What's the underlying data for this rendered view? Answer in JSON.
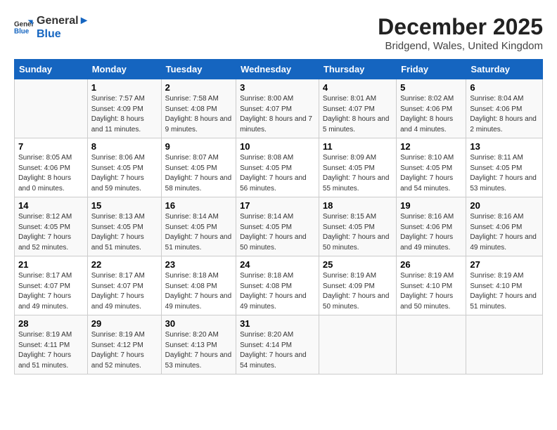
{
  "logo": {
    "line1": "General",
    "line2": "Blue"
  },
  "title": "December 2025",
  "subtitle": "Bridgend, Wales, United Kingdom",
  "days_of_week": [
    "Sunday",
    "Monday",
    "Tuesday",
    "Wednesday",
    "Thursday",
    "Friday",
    "Saturday"
  ],
  "weeks": [
    [
      {
        "day": "",
        "sunrise": "",
        "sunset": "",
        "daylight": ""
      },
      {
        "day": "1",
        "sunrise": "Sunrise: 7:57 AM",
        "sunset": "Sunset: 4:09 PM",
        "daylight": "Daylight: 8 hours and 11 minutes."
      },
      {
        "day": "2",
        "sunrise": "Sunrise: 7:58 AM",
        "sunset": "Sunset: 4:08 PM",
        "daylight": "Daylight: 8 hours and 9 minutes."
      },
      {
        "day": "3",
        "sunrise": "Sunrise: 8:00 AM",
        "sunset": "Sunset: 4:07 PM",
        "daylight": "Daylight: 8 hours and 7 minutes."
      },
      {
        "day": "4",
        "sunrise": "Sunrise: 8:01 AM",
        "sunset": "Sunset: 4:07 PM",
        "daylight": "Daylight: 8 hours and 5 minutes."
      },
      {
        "day": "5",
        "sunrise": "Sunrise: 8:02 AM",
        "sunset": "Sunset: 4:06 PM",
        "daylight": "Daylight: 8 hours and 4 minutes."
      },
      {
        "day": "6",
        "sunrise": "Sunrise: 8:04 AM",
        "sunset": "Sunset: 4:06 PM",
        "daylight": "Daylight: 8 hours and 2 minutes."
      }
    ],
    [
      {
        "day": "7",
        "sunrise": "Sunrise: 8:05 AM",
        "sunset": "Sunset: 4:06 PM",
        "daylight": "Daylight: 8 hours and 0 minutes."
      },
      {
        "day": "8",
        "sunrise": "Sunrise: 8:06 AM",
        "sunset": "Sunset: 4:05 PM",
        "daylight": "Daylight: 7 hours and 59 minutes."
      },
      {
        "day": "9",
        "sunrise": "Sunrise: 8:07 AM",
        "sunset": "Sunset: 4:05 PM",
        "daylight": "Daylight: 7 hours and 58 minutes."
      },
      {
        "day": "10",
        "sunrise": "Sunrise: 8:08 AM",
        "sunset": "Sunset: 4:05 PM",
        "daylight": "Daylight: 7 hours and 56 minutes."
      },
      {
        "day": "11",
        "sunrise": "Sunrise: 8:09 AM",
        "sunset": "Sunset: 4:05 PM",
        "daylight": "Daylight: 7 hours and 55 minutes."
      },
      {
        "day": "12",
        "sunrise": "Sunrise: 8:10 AM",
        "sunset": "Sunset: 4:05 PM",
        "daylight": "Daylight: 7 hours and 54 minutes."
      },
      {
        "day": "13",
        "sunrise": "Sunrise: 8:11 AM",
        "sunset": "Sunset: 4:05 PM",
        "daylight": "Daylight: 7 hours and 53 minutes."
      }
    ],
    [
      {
        "day": "14",
        "sunrise": "Sunrise: 8:12 AM",
        "sunset": "Sunset: 4:05 PM",
        "daylight": "Daylight: 7 hours and 52 minutes."
      },
      {
        "day": "15",
        "sunrise": "Sunrise: 8:13 AM",
        "sunset": "Sunset: 4:05 PM",
        "daylight": "Daylight: 7 hours and 51 minutes."
      },
      {
        "day": "16",
        "sunrise": "Sunrise: 8:14 AM",
        "sunset": "Sunset: 4:05 PM",
        "daylight": "Daylight: 7 hours and 51 minutes."
      },
      {
        "day": "17",
        "sunrise": "Sunrise: 8:14 AM",
        "sunset": "Sunset: 4:05 PM",
        "daylight": "Daylight: 7 hours and 50 minutes."
      },
      {
        "day": "18",
        "sunrise": "Sunrise: 8:15 AM",
        "sunset": "Sunset: 4:05 PM",
        "daylight": "Daylight: 7 hours and 50 minutes."
      },
      {
        "day": "19",
        "sunrise": "Sunrise: 8:16 AM",
        "sunset": "Sunset: 4:06 PM",
        "daylight": "Daylight: 7 hours and 49 minutes."
      },
      {
        "day": "20",
        "sunrise": "Sunrise: 8:16 AM",
        "sunset": "Sunset: 4:06 PM",
        "daylight": "Daylight: 7 hours and 49 minutes."
      }
    ],
    [
      {
        "day": "21",
        "sunrise": "Sunrise: 8:17 AM",
        "sunset": "Sunset: 4:07 PM",
        "daylight": "Daylight: 7 hours and 49 minutes."
      },
      {
        "day": "22",
        "sunrise": "Sunrise: 8:17 AM",
        "sunset": "Sunset: 4:07 PM",
        "daylight": "Daylight: 7 hours and 49 minutes."
      },
      {
        "day": "23",
        "sunrise": "Sunrise: 8:18 AM",
        "sunset": "Sunset: 4:08 PM",
        "daylight": "Daylight: 7 hours and 49 minutes."
      },
      {
        "day": "24",
        "sunrise": "Sunrise: 8:18 AM",
        "sunset": "Sunset: 4:08 PM",
        "daylight": "Daylight: 7 hours and 49 minutes."
      },
      {
        "day": "25",
        "sunrise": "Sunrise: 8:19 AM",
        "sunset": "Sunset: 4:09 PM",
        "daylight": "Daylight: 7 hours and 50 minutes."
      },
      {
        "day": "26",
        "sunrise": "Sunrise: 8:19 AM",
        "sunset": "Sunset: 4:10 PM",
        "daylight": "Daylight: 7 hours and 50 minutes."
      },
      {
        "day": "27",
        "sunrise": "Sunrise: 8:19 AM",
        "sunset": "Sunset: 4:10 PM",
        "daylight": "Daylight: 7 hours and 51 minutes."
      }
    ],
    [
      {
        "day": "28",
        "sunrise": "Sunrise: 8:19 AM",
        "sunset": "Sunset: 4:11 PM",
        "daylight": "Daylight: 7 hours and 51 minutes."
      },
      {
        "day": "29",
        "sunrise": "Sunrise: 8:19 AM",
        "sunset": "Sunset: 4:12 PM",
        "daylight": "Daylight: 7 hours and 52 minutes."
      },
      {
        "day": "30",
        "sunrise": "Sunrise: 8:20 AM",
        "sunset": "Sunset: 4:13 PM",
        "daylight": "Daylight: 7 hours and 53 minutes."
      },
      {
        "day": "31",
        "sunrise": "Sunrise: 8:20 AM",
        "sunset": "Sunset: 4:14 PM",
        "daylight": "Daylight: 7 hours and 54 minutes."
      },
      {
        "day": "",
        "sunrise": "",
        "sunset": "",
        "daylight": ""
      },
      {
        "day": "",
        "sunrise": "",
        "sunset": "",
        "daylight": ""
      },
      {
        "day": "",
        "sunrise": "",
        "sunset": "",
        "daylight": ""
      }
    ]
  ]
}
